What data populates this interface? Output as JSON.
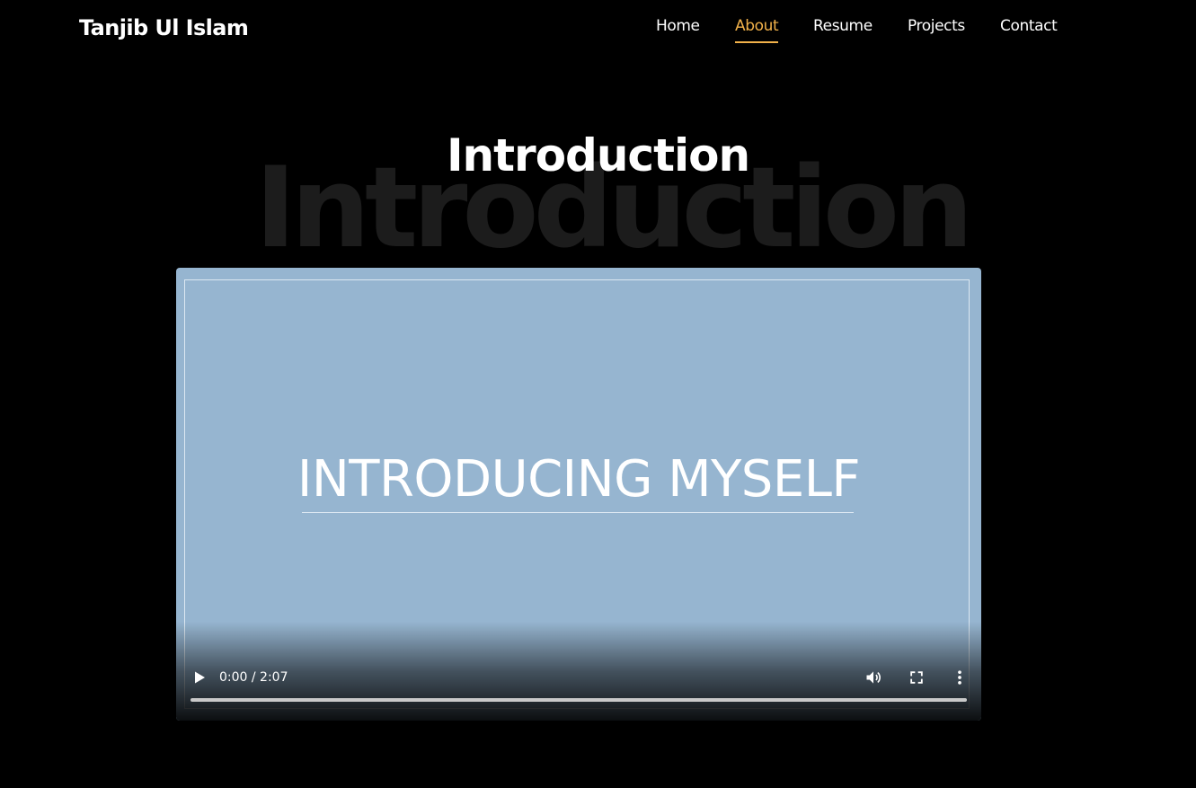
{
  "header": {
    "brand": "Tanjib Ul Islam",
    "nav": [
      {
        "label": "Home",
        "active": false
      },
      {
        "label": "About",
        "active": true
      },
      {
        "label": "Resume",
        "active": false
      },
      {
        "label": "Projects",
        "active": false
      },
      {
        "label": "Contact",
        "active": false
      }
    ]
  },
  "section": {
    "title": "Introduction",
    "background_title": "Introduction"
  },
  "video": {
    "slide_text": "INTRODUCING MYSELF",
    "current_time": "0:00",
    "duration": "2:07",
    "time_display": "0:00 / 2:07",
    "progress": 0,
    "icons": {
      "play": "play-icon",
      "volume": "volume-icon",
      "fullscreen": "fullscreen-icon",
      "more": "more-vertical-icon"
    }
  },
  "colors": {
    "background": "#000000",
    "accent": "#f2b24a",
    "video_background": "#96b5d0"
  }
}
